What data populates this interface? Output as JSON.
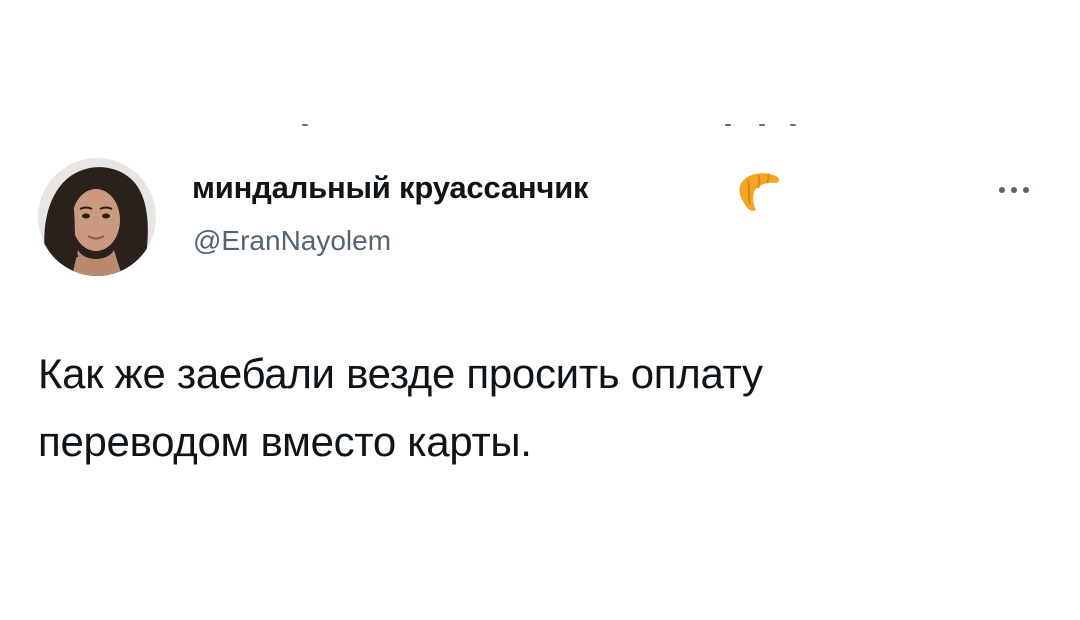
{
  "tweet": {
    "display_name": "миндальный круассанчик",
    "name_emoji_icon": "croissant-icon",
    "handle": "@EranNayolem",
    "more_icon": "more-horizontal-icon",
    "text_lines": [
      "Как же заебали везде просить оплату",
      "переводом вместо карты."
    ]
  },
  "colors": {
    "text_primary": "#0f1419",
    "text_secondary": "#536471",
    "background": "#ffffff",
    "croissant": "#f4a623"
  }
}
